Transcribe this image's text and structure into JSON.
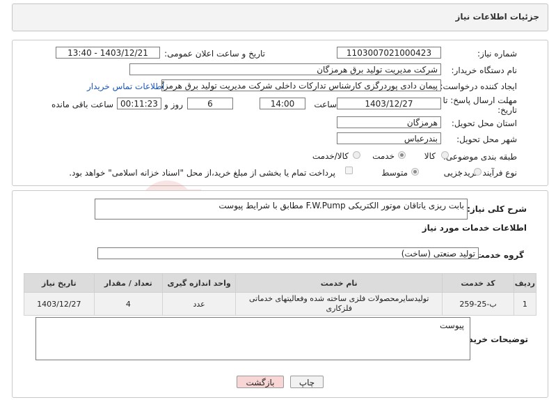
{
  "header": {
    "title": "جزئیات اطلاعات نیاز"
  },
  "form": {
    "need_number_label": "شماره نیاز:",
    "need_number": "1103007021000423",
    "announce_label": "تاریخ و ساعت اعلان عمومی:",
    "announce_value": "1403/12/21 - 13:40",
    "buyer_label": "نام دستگاه خریدار:",
    "buyer_value": "شرکت مدیریت تولید برق هرمزگان",
    "creator_label": "ایجاد کننده درخواست:",
    "creator_value": "پیمان دادی پوردرگزی کارشناس تدارکات داخلی شرکت مدیریت تولید برق هرمزگا",
    "contact_link": "اطلاعات تماس خریدار",
    "deadline_label_1": "مهلت ارسال پاسخ: تا",
    "deadline_label_2": "تاریخ:",
    "deadline_date": "1403/12/27",
    "time_label": "ساعت",
    "deadline_time": "14:00",
    "days_value": "6",
    "days_label": "روز و",
    "remaining_value": "00:11:23",
    "remaining_label": "ساعت باقی مانده",
    "province_label": "استان محل تحویل:",
    "province_value": "هرمزگان",
    "city_label": "شهر محل تحویل:",
    "city_value": "بندرعباس",
    "category_label": "طبقه بندی موضوعی:",
    "category_options": [
      "کالا",
      "خدمت",
      "کالا/خدمت"
    ],
    "category_selected": "خدمت",
    "process_label": "نوع فرآیند خرید :",
    "process_options": [
      "جزیی",
      "متوسط"
    ],
    "process_selected": "متوسط",
    "payment_note": "پرداخت تمام یا بخشی از مبلغ خرید،از محل \"اسناد خزانه اسلامی\" خواهد بود."
  },
  "summary": {
    "label": "شرح کلی نیاز:",
    "value": "بابت ریزی یاتاقان موتور الکتریکی F.W.Pump مطابق با شرایط پیوست"
  },
  "services": {
    "section_title": "اطلاعات خدمات مورد نیاز",
    "group_label": "گروه خدمت:",
    "group_value": "تولید صنعتی (ساخت)",
    "columns": [
      "ردیف",
      "کد خدمت",
      "نام خدمت",
      "واحد اندازه گیری",
      "تعداد / مقدار",
      "تاریخ نیاز"
    ],
    "rows": [
      {
        "idx": "1",
        "code": "ب-25-259",
        "name": "تولیدسایرمحصولات فلزی ساخته شده وفعالیتهای خدماتی فلزکاری",
        "unit": "عدد",
        "qty": "4",
        "date": "1403/12/27"
      }
    ]
  },
  "buyer_notes": {
    "label": "توضیحات خریدار:",
    "value": "پیوست"
  },
  "buttons": {
    "print": "چاپ",
    "back": "بازگشت"
  },
  "watermark": {
    "text": "AriaTender.neT"
  },
  "colors": {
    "back_button_bg": "#f9d6d6",
    "print_button_bg": "#f2f2f2",
    "link": "#1a56b8"
  }
}
